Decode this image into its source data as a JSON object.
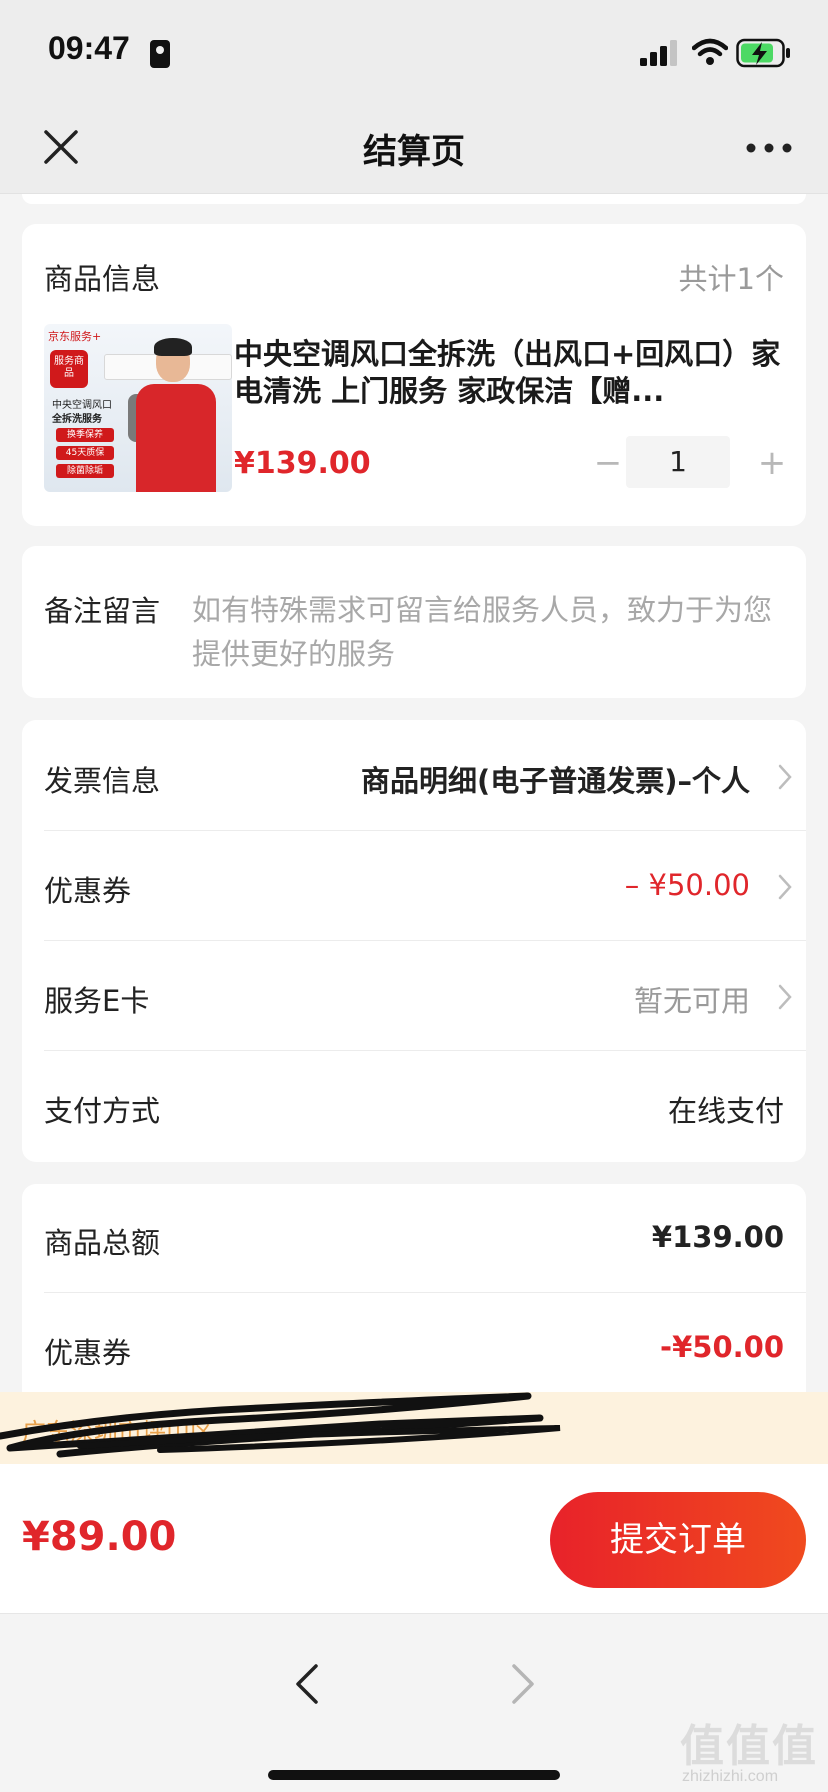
{
  "status_bar": {
    "time": "09:47"
  },
  "nav": {
    "title": "结算页"
  },
  "product_card": {
    "section_label": "商品信息",
    "count_text": "共计1个",
    "thumbnail": {
      "brand": "京东服务+",
      "badge": "服务商品",
      "title_line1": "中央空调风口",
      "title_line2": "全拆洗服务",
      "pills": [
        "换季保养",
        "45天质保",
        "除菌除垢"
      ]
    },
    "title": "中央空调风口全拆洗（出风口+回风口）家电清洗 上门服务 家政保洁【赠...",
    "price": "¥139.00",
    "quantity": "1",
    "minus_symbol": "−",
    "plus_symbol": "+"
  },
  "remark": {
    "label": "备注留言",
    "placeholder": "如有特殊需求可留言给服务人员，致力于为您提供更好的服务"
  },
  "info_rows": {
    "invoice": {
      "label": "发票信息",
      "value": "商品明细(电子普通发票)–个人"
    },
    "coupon": {
      "label": "优惠券",
      "value": "– ¥50.00"
    },
    "ecard": {
      "label": "服务E卡",
      "value": "暂无可用"
    },
    "payment": {
      "label": "支付方式",
      "value": "在线支付"
    }
  },
  "summary": {
    "goods_total_label": "商品总额",
    "goods_total_value": "¥139.00",
    "coupon_label": "优惠券",
    "coupon_value": "-¥50.00"
  },
  "address_notice": {
    "text": "广东深圳市坪山区"
  },
  "bottom_bar": {
    "total": "¥89.00",
    "submit_label": "提交订单"
  },
  "watermark": {
    "glyphs": "值值值",
    "url": "zhizhizhi.com"
  },
  "colors": {
    "accent_red": "#e0262b",
    "submit_gradient_start": "#e8222a",
    "submit_gradient_end": "#f04a1e",
    "notice_bg": "#fdf2de",
    "notice_text": "#e8a04a"
  }
}
